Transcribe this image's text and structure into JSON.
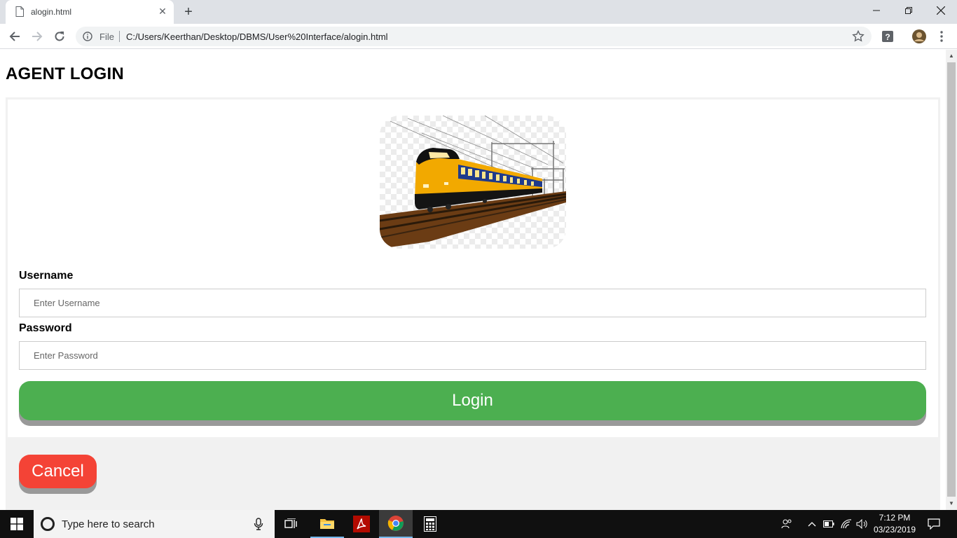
{
  "browser": {
    "tab_title": "alogin.html",
    "scheme_label": "File",
    "url": "C:/Users/Keerthan/Desktop/DBMS/User%20Interface/alogin.html"
  },
  "page": {
    "title": "AGENT LOGIN",
    "image": "train-illustration",
    "username_label": "Username",
    "username_placeholder": "Enter Username",
    "password_label": "Password",
    "password_placeholder": "Enter Password",
    "login_label": "Login",
    "cancel_label": "Cancel"
  },
  "colors": {
    "login_button": "#4caf50",
    "cancel_button": "#f44336"
  },
  "taskbar": {
    "search_placeholder": "Type here to search",
    "time": "7:12 PM",
    "date": "03/23/2019",
    "apps": [
      "task-view",
      "file-explorer",
      "acrobat-reader",
      "chrome",
      "calculator"
    ]
  }
}
